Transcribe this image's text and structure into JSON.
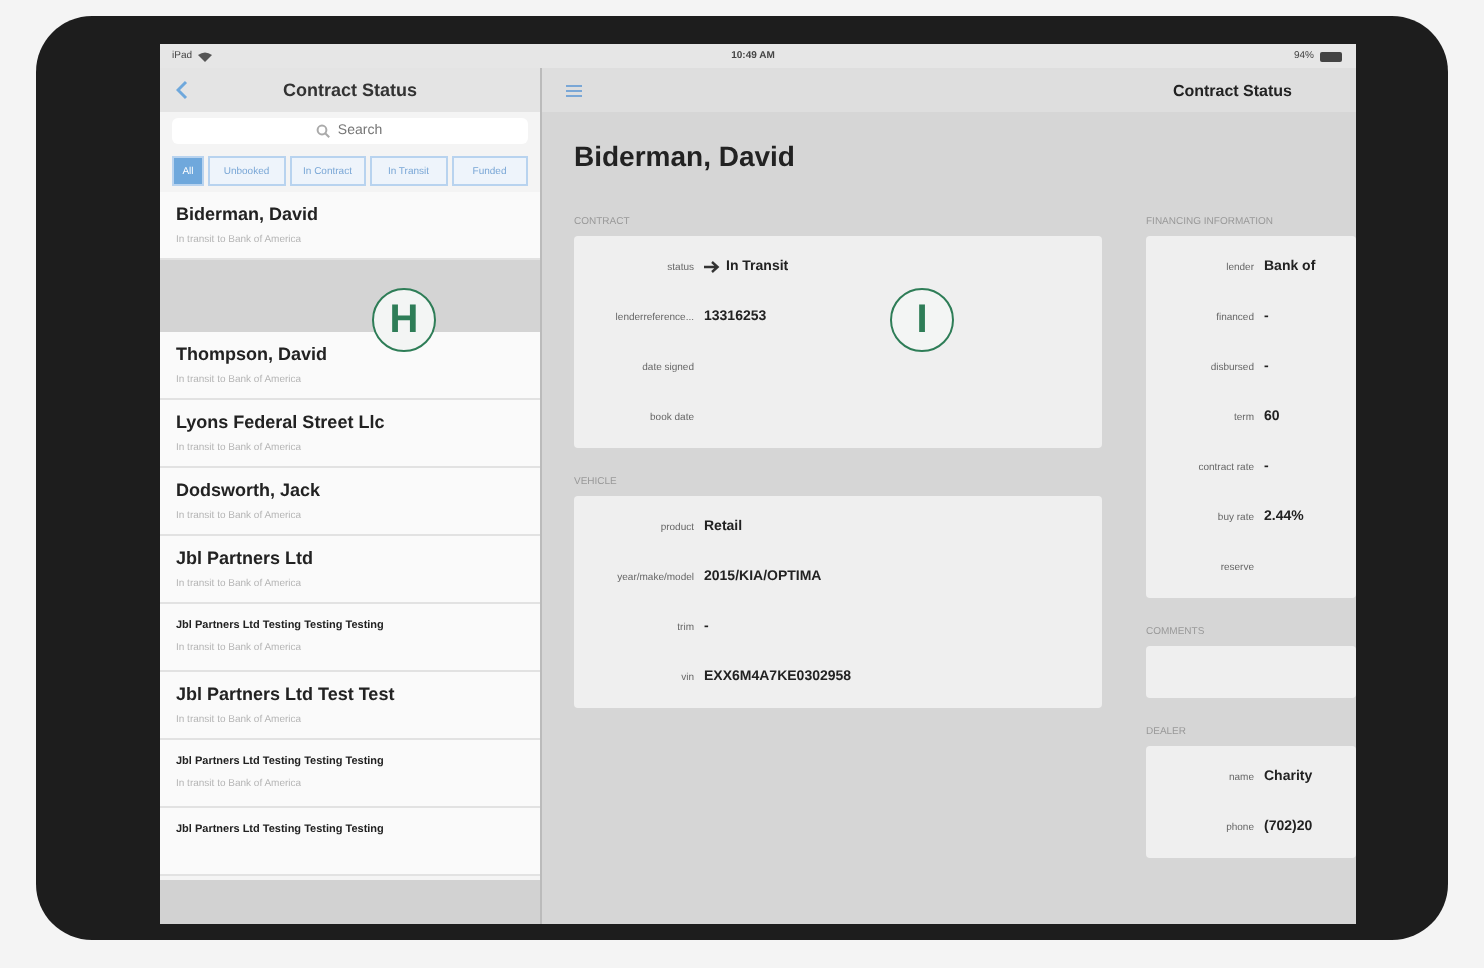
{
  "status_bar": {
    "carrier": "iPad",
    "time": "10:49 AM",
    "battery": "94%"
  },
  "sidebar": {
    "title": "Contract Status",
    "search": {
      "placeholder": "Search"
    },
    "filters": [
      {
        "label": "All",
        "selected": true
      },
      {
        "label": "Unbooked",
        "selected": false
      },
      {
        "label": "In Contract",
        "selected": false
      },
      {
        "label": "In Transit",
        "selected": false
      },
      {
        "label": "Funded",
        "selected": false
      }
    ],
    "items": [
      {
        "kind": "regular",
        "name": "Biderman, David",
        "subtitle": "In transit to Bank of America"
      },
      {
        "kind": "blank"
      },
      {
        "kind": "regular",
        "name": "Thompson, David",
        "subtitle": "In transit to Bank of America"
      },
      {
        "kind": "regular",
        "name": "Lyons Federal Street Llc",
        "subtitle": "In transit to Bank of America"
      },
      {
        "kind": "regular",
        "name": "Dodsworth, Jack",
        "subtitle": "In transit to Bank of America"
      },
      {
        "kind": "regular",
        "name": "Jbl Partners Ltd",
        "subtitle": "In transit to Bank of America"
      },
      {
        "kind": "small",
        "name": "Jbl Partners Ltd Testing Testing Testing",
        "subtitle": "In transit to Bank of America"
      },
      {
        "kind": "regular",
        "name": "Jbl Partners Ltd Test Test",
        "subtitle": "In transit to Bank of America"
      },
      {
        "kind": "small",
        "name": "Jbl Partners Ltd Testing Testing Testing",
        "subtitle": "In transit to Bank of America"
      },
      {
        "kind": "small",
        "name": "Jbl Partners Ltd Testing Testing Testing"
      }
    ]
  },
  "detail": {
    "nav_title": "Contract Status",
    "customer": "Biderman, David",
    "left_sections": [
      {
        "title": "CONTRACT",
        "fields": [
          {
            "label": "status",
            "value": "In Transit",
            "kind": "status"
          },
          {
            "label": "lenderreference...",
            "value": "13316253"
          },
          {
            "label": "date signed"
          },
          {
            "label": "book date"
          }
        ]
      },
      {
        "title": "VEHICLE",
        "fields": [
          {
            "label": "product",
            "value": "Retail"
          },
          {
            "label": "year/make/model",
            "value": "2015/KIA/OPTIMA"
          },
          {
            "label": "trim",
            "value": "-"
          },
          {
            "label": "vin",
            "value": "EXX6M4A7KE0302958"
          }
        ]
      }
    ],
    "right_sections": [
      {
        "title": "FINANCING INFORMATION",
        "fields": [
          {
            "label": "lender",
            "value": "Bank of"
          },
          {
            "label": "financed",
            "value": "-"
          },
          {
            "label": "disbursed",
            "value": "-"
          },
          {
            "label": "term",
            "value": "60"
          },
          {
            "label": "contract rate",
            "value": "-"
          },
          {
            "label": "buy rate",
            "value": "2.44%"
          },
          {
            "label": "reserve"
          }
        ]
      },
      {
        "title": "COMMENTS"
      },
      {
        "title": "DEALER",
        "fields": [
          {
            "label": "name",
            "value": "Charity"
          },
          {
            "label": "phone",
            "value": "(702)20"
          }
        ]
      }
    ]
  },
  "annotations": [
    {
      "letter": "H"
    },
    {
      "letter": "I"
    }
  ]
}
